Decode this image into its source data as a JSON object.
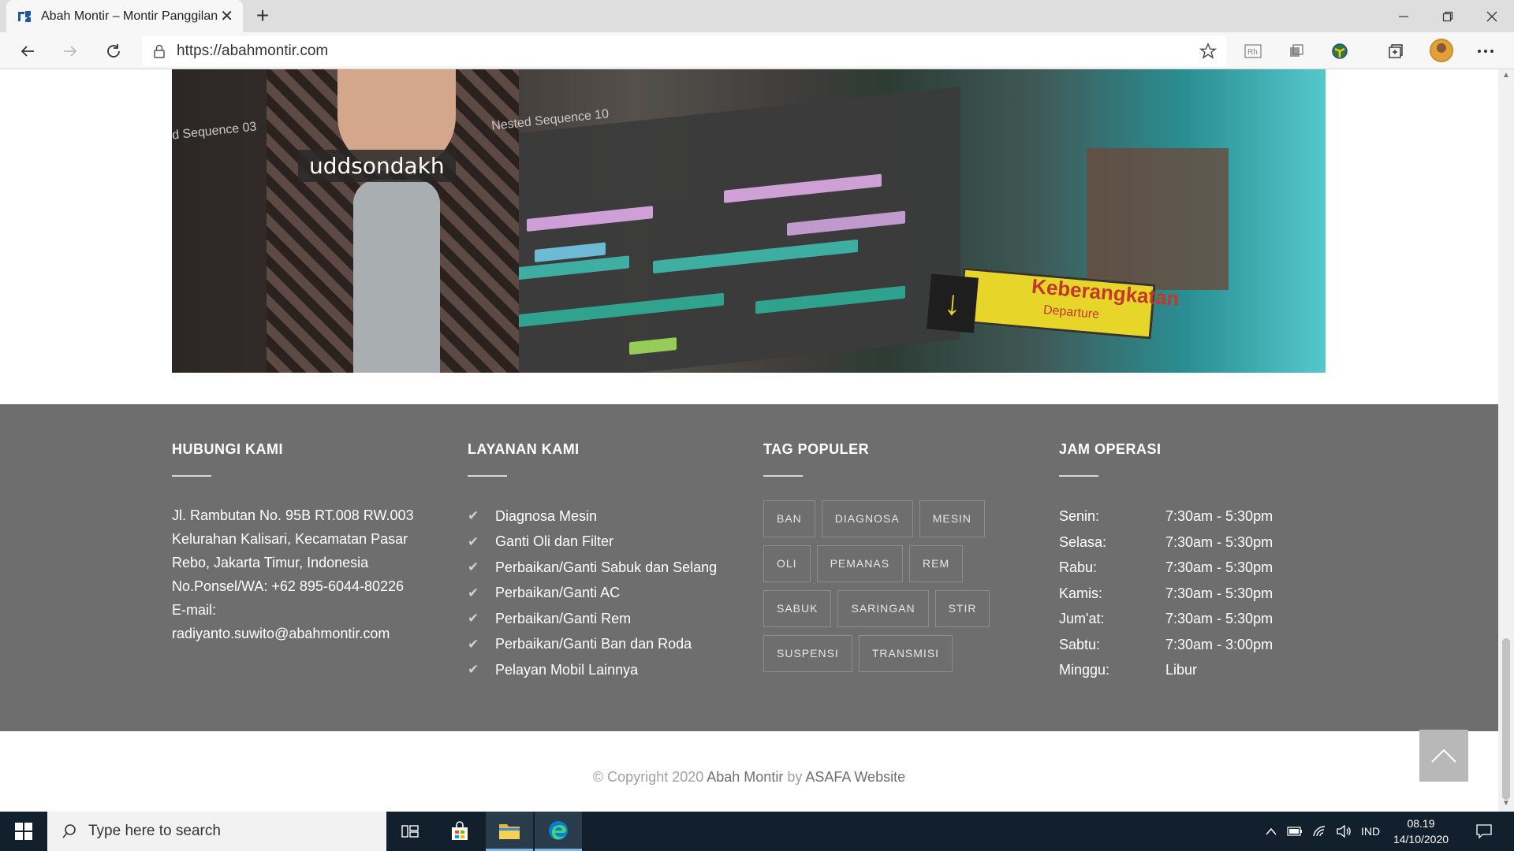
{
  "browser": {
    "tab_title": "Abah Montir – Montir Panggilan",
    "tab_close": "✕",
    "new_tab": "+",
    "url": "https://abahmontir.com",
    "icons": [
      "back-icon",
      "forward-icon",
      "refresh-icon",
      "lock-icon",
      "star-icon",
      "reader-icon",
      "extension-icon",
      "extension-globe-icon",
      "collections-icon",
      "profile-avatar",
      "more-icon"
    ]
  },
  "hero": {
    "name_card": "uddsondakh",
    "sequence_left": "d Sequence 03",
    "sequence_nested": "Nested Sequence 10",
    "sign_main": "Keberangkatan",
    "sign_sub": "Departure"
  },
  "footer": {
    "contact": {
      "title": "HUBUNGI KAMI",
      "lines": [
        "Jl. Rambutan No. 95B RT.008 RW.003",
        "Kelurahan Kalisari, Kecamatan Pasar",
        "Rebo, Jakarta Timur, Indonesia",
        "No.Ponsel/WA: +62 895-6044-80226",
        "E-mail:",
        "radiyanto.suwito@abahmontir.com"
      ]
    },
    "services": {
      "title": "LAYANAN KAMI",
      "items": [
        "Diagnosa Mesin",
        "Ganti Oli dan Filter",
        "Perbaikan/Ganti Sabuk dan Selang",
        "Perbaikan/Ganti AC",
        "Perbaikan/Ganti Rem",
        "Perbaikan/Ganti Ban dan Roda",
        "Pelayan Mobil Lainnya"
      ]
    },
    "tags": {
      "title": "TAG POPULER",
      "items": [
        "BAN",
        "DIAGNOSA",
        "MESIN",
        "OLI",
        "PEMANAS",
        "REM",
        "SABUK",
        "SARINGAN",
        "STIR",
        "SUSPENSI",
        "TRANSMISI"
      ]
    },
    "hours": {
      "title": "JAM OPERASI",
      "rows": [
        {
          "day": "Senin:",
          "time": "7:30am - 5:30pm"
        },
        {
          "day": "Selasa:",
          "time": "7:30am - 5:30pm"
        },
        {
          "day": "Rabu:",
          "time": "7:30am - 5:30pm"
        },
        {
          "day": "Kamis:",
          "time": "7:30am - 5:30pm"
        },
        {
          "day": "Jum'at:",
          "time": "7:30am - 5:30pm"
        },
        {
          "day": "Sabtu:",
          "time": "7:30am - 3:00pm"
        },
        {
          "day": "Minggu:",
          "time": "Libur"
        }
      ]
    }
  },
  "copyright": {
    "prefix": "© Copyright 2020 ",
    "site": "Abah Montir",
    "by": " by ",
    "author": "ASAFA Website"
  },
  "taskbar": {
    "search_placeholder": "Type here to search",
    "language": "IND",
    "time": "08.19",
    "date": "14/10/2020"
  }
}
